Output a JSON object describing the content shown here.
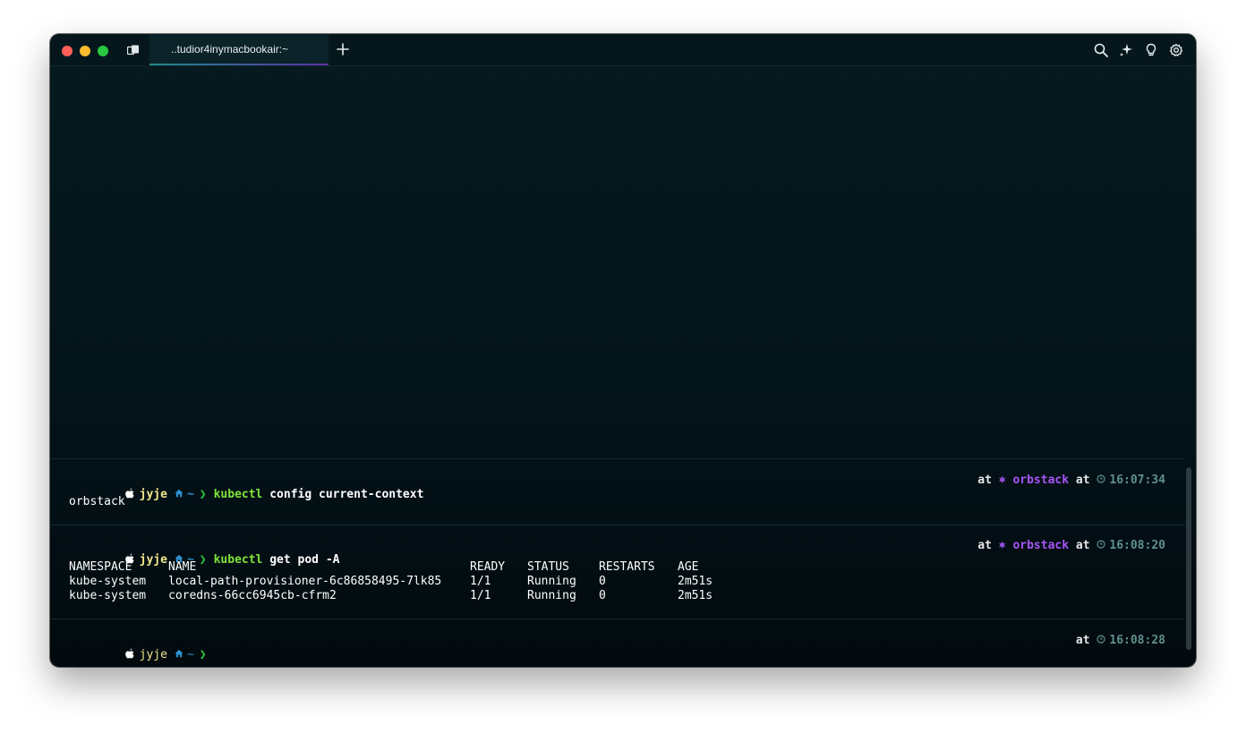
{
  "window": {
    "tab_title": "..tudior4inymacbookair:~"
  },
  "icons": {
    "titlebar": [
      "tabs-icon",
      "new-tab-icon",
      "search-icon",
      "sparkle-icon",
      "lightbulb-icon",
      "settings-icon"
    ],
    "prompt": [
      "apple-icon",
      "home-icon",
      "clock-icon"
    ]
  },
  "colors": {
    "username": "#f0e68c",
    "command": "#7ee23b",
    "context": "#a855f7",
    "time": "#5f8f8f",
    "tab_underline": [
      "#1f8a8a",
      "#5b2fa8"
    ]
  },
  "blocks": [
    {
      "user": "jyje",
      "dir": "~",
      "chevron": "❯",
      "command": "kubectl",
      "args": "config current-context",
      "at1": "at",
      "context_icon": "⎈",
      "context": "orbstack",
      "at2": "at",
      "time": "16:07:34",
      "output": "orbstack"
    },
    {
      "user": "jyje",
      "dir": "~",
      "chevron": "❯",
      "command": "kubectl",
      "args": "get pod -A",
      "at1": "at",
      "context_icon": "⎈",
      "context": "orbstack",
      "at2": "at",
      "time": "16:08:20",
      "table": {
        "headers": [
          "NAMESPACE",
          "NAME",
          "READY",
          "STATUS",
          "RESTARTS",
          "AGE"
        ],
        "rows": [
          [
            "kube-system",
            "local-path-provisioner-6c86858495-7lk85",
            "1/1",
            "Running",
            "0",
            "2m51s"
          ],
          [
            "kube-system",
            "coredns-66cc6945cb-cfrm2",
            "1/1",
            "Running",
            "0",
            "2m51s"
          ]
        ]
      }
    },
    {
      "user": "jyje",
      "dir": "~",
      "chevron": "❯",
      "at": "at",
      "time": "16:08:28"
    }
  ]
}
